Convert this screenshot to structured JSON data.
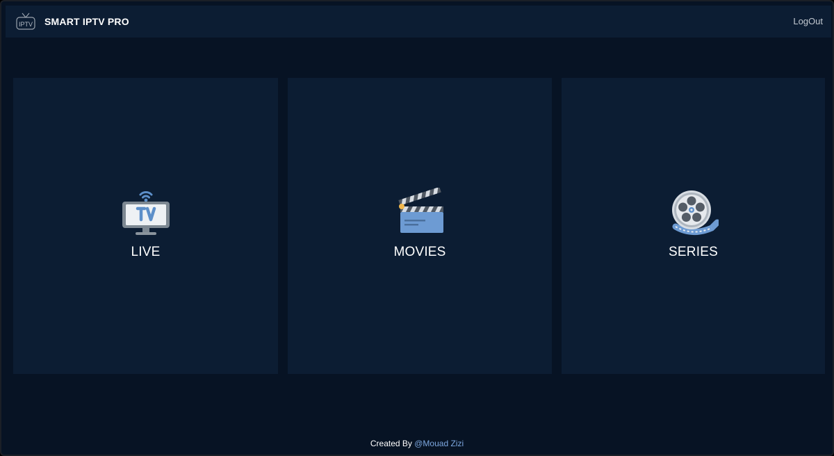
{
  "header": {
    "brand_title": "SMART IPTV PRO",
    "logo_text": "IPTV",
    "logout_label": "LogOut"
  },
  "categories": [
    {
      "label": "LIVE",
      "icon": "tv-icon"
    },
    {
      "label": "MOVIES",
      "icon": "clapperboard-icon"
    },
    {
      "label": "SERIES",
      "icon": "film-reel-icon"
    }
  ],
  "footer": {
    "prefix": "Created By",
    "author": "@Mouad Zizi"
  },
  "colors": {
    "background": "#071324",
    "panel": "#0c1d33",
    "accent": "#7da8e0",
    "text": "#ffffff"
  }
}
